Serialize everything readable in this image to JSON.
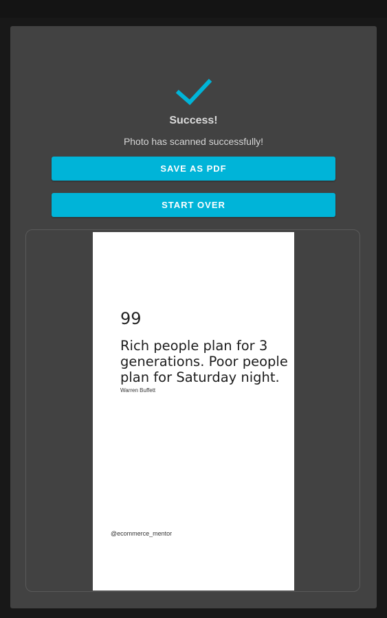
{
  "status": {
    "icon": "checkmark-icon",
    "title": "Success!",
    "message": "Photo has scanned successfully!",
    "accent_color": "#00b4d8"
  },
  "actions": {
    "save_label": "SAVE AS PDF",
    "start_over_label": "START OVER"
  },
  "preview": {
    "quote_mark": "99",
    "quote": "Rich people plan for 3 generations. Poor people plan for Saturday night.",
    "author": "Warren Buffett",
    "handle": "@ecommerce_mentor"
  }
}
